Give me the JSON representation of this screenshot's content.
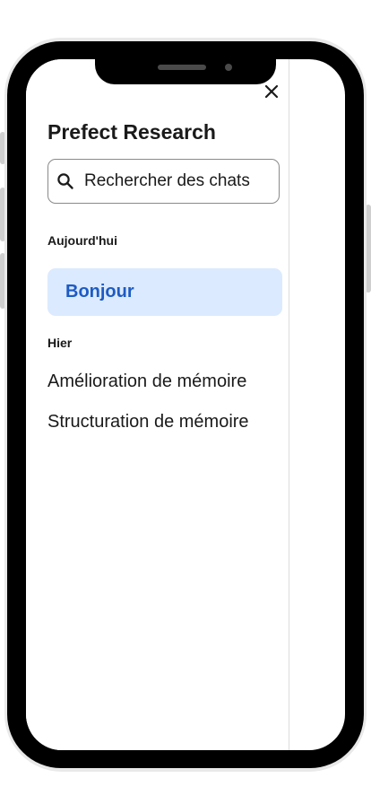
{
  "drawer": {
    "title": "Prefect Research",
    "close_icon": "close-icon",
    "search": {
      "placeholder": "Rechercher des chats",
      "value": "",
      "icon": "search-icon"
    },
    "sections": [
      {
        "label": "Aujourd'hui",
        "items": [
          {
            "label": "Bonjour",
            "active": true
          }
        ]
      },
      {
        "label": "Hier",
        "items": [
          {
            "label": "Amélioration de mémoire",
            "active": false
          },
          {
            "label": "Structuration de mémoire",
            "active": false
          }
        ]
      }
    ]
  },
  "colors": {
    "active_background": "#dbeafe",
    "active_text": "#1d5bc4",
    "text": "#1a1a1a",
    "frame": "#000000"
  }
}
